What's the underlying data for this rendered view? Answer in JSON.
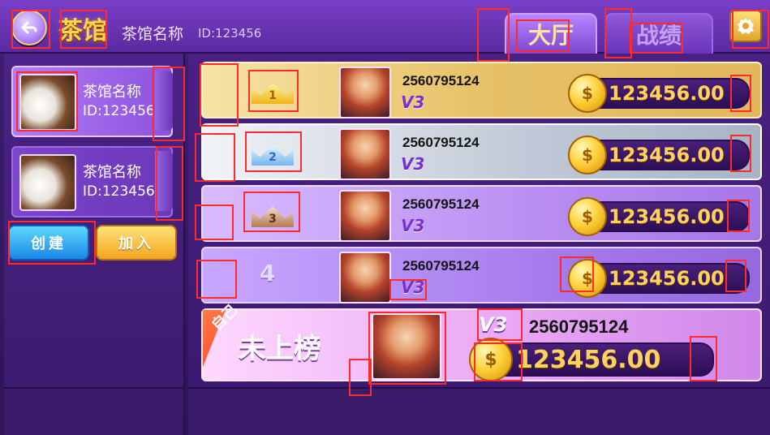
{
  "topbar": {
    "back_icon": "back-arrow-icon",
    "logo_text": "茶馆",
    "hall_name": "茶馆名称",
    "hall_id": "ID:123456",
    "tabs": [
      {
        "label": "大厅"
      },
      {
        "label": "战绩"
      }
    ],
    "settings_icon": "gear-icon"
  },
  "sidebar": {
    "items": [
      {
        "name": "茶馆名称",
        "id": "ID:123456",
        "active": true,
        "icon": "tea-set-thumbnail"
      },
      {
        "name": "茶馆名称",
        "id": "ID:123456",
        "active": false,
        "icon": "tea-set-thumbnail"
      }
    ],
    "create_label": "创建",
    "join_label": "加入"
  },
  "leaderboard": {
    "rows": [
      {
        "rank": "1",
        "user_id": "2560795124",
        "vip": "V3",
        "coins": "123456.00",
        "medal": "gold-crown-icon"
      },
      {
        "rank": "2",
        "user_id": "2560795124",
        "vip": "V3",
        "coins": "123456.00",
        "medal": "silver-crown-icon"
      },
      {
        "rank": "3",
        "user_id": "2560795124",
        "vip": "V3",
        "coins": "123456.00",
        "medal": "bronze-crown-icon"
      },
      {
        "rank": "4",
        "user_id": "2560795124",
        "vip": "V3",
        "coins": "123456.00",
        "medal": ""
      }
    ],
    "me": {
      "badge": "自己",
      "status": "未上榜",
      "vip": "V3",
      "user_id": "2560795124",
      "coins": "123456.00"
    },
    "coin_symbol": "$"
  },
  "colors": {
    "accent_gold": "#ffd35b",
    "primary_purple": "#6a34b8",
    "highlight_red": "#ff2a2a"
  }
}
